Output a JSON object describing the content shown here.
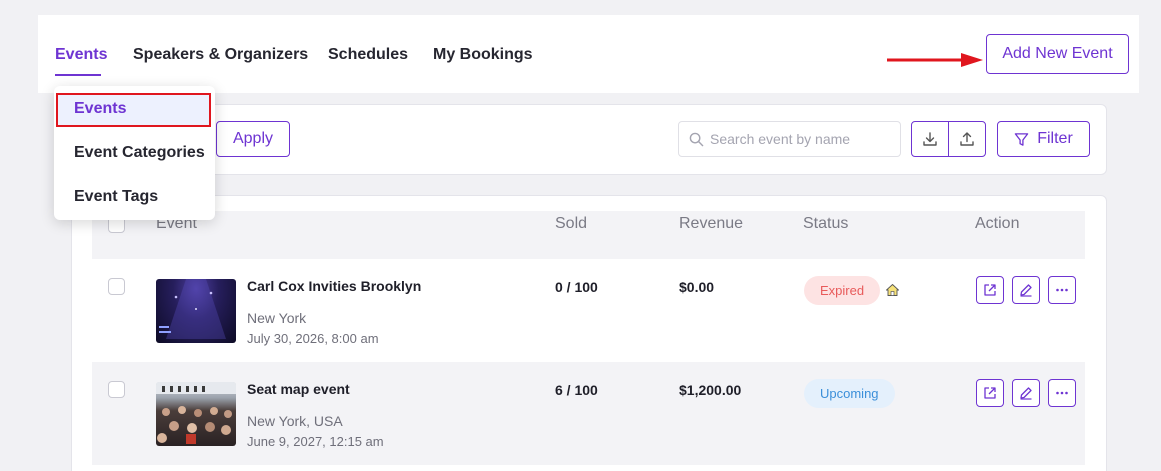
{
  "tabs": [
    {
      "label": "Events",
      "active": true
    },
    {
      "label": "Speakers & Organizers"
    },
    {
      "label": "Schedules"
    },
    {
      "label": "My Bookings"
    }
  ],
  "add_event_label": "Add New Event",
  "dropdown": {
    "items": [
      {
        "label": "Events",
        "selected": true
      },
      {
        "label": "Event Categories"
      },
      {
        "label": "Event Tags"
      }
    ]
  },
  "toolbar": {
    "apply_label": "Apply",
    "search_placeholder": "Search event by name",
    "filter_label": "Filter"
  },
  "table": {
    "headers": {
      "event": "Event",
      "sold": "Sold",
      "revenue": "Revenue",
      "status": "Status",
      "action": "Action"
    },
    "rows": [
      {
        "title": "Carl Cox Invities Brooklyn",
        "location": "New York",
        "date": "July 30, 2026, 8:00 am",
        "sold": "0 / 100",
        "revenue": "$0.00",
        "status": "Expired",
        "status_color": "#e85a5a",
        "status_bg": "#fde3e3"
      },
      {
        "title": "Seat map event",
        "location": "New York, USA",
        "date": "June 9, 2027, 12:15 am",
        "sold": "6 / 100",
        "revenue": "$1,200.00",
        "status": "Upcoming",
        "status_color": "#3b8fd9",
        "status_bg": "#e4f0fc"
      }
    ]
  },
  "colors": {
    "accent": "#6e34d2",
    "highlight_red": "#e0161e"
  }
}
